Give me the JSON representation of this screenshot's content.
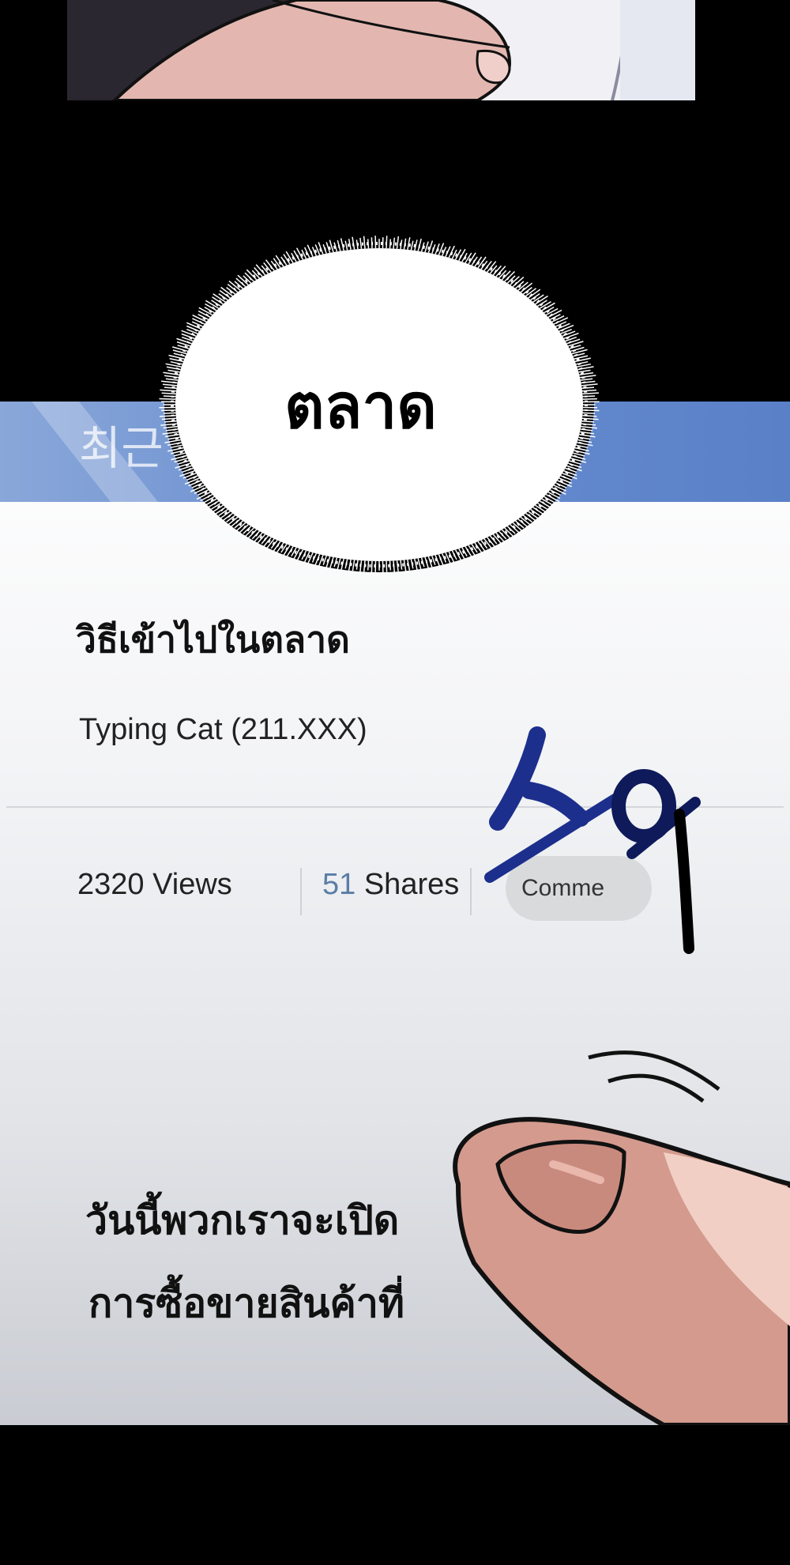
{
  "blue_bar": {
    "label": "최근"
  },
  "speech_bubble": {
    "text": "ตลาด"
  },
  "post": {
    "title": "วิธีเข้าไปในตลาด",
    "author": "Typing Cat (211.XXX)",
    "views": "2320 Views",
    "shares_count": "51",
    "shares_label": " Shares",
    "comment_label": "Comme"
  },
  "sfx": {
    "text": "스윽"
  },
  "captions": {
    "line1": "วันนี้พวกเราจะเปิด",
    "line2": "การซื้อขายสินค้าที่"
  },
  "colors": {
    "blue_bar": "#5a80c8",
    "shares_number": "#5a7ea6",
    "sfx": "#1c2f8c"
  }
}
